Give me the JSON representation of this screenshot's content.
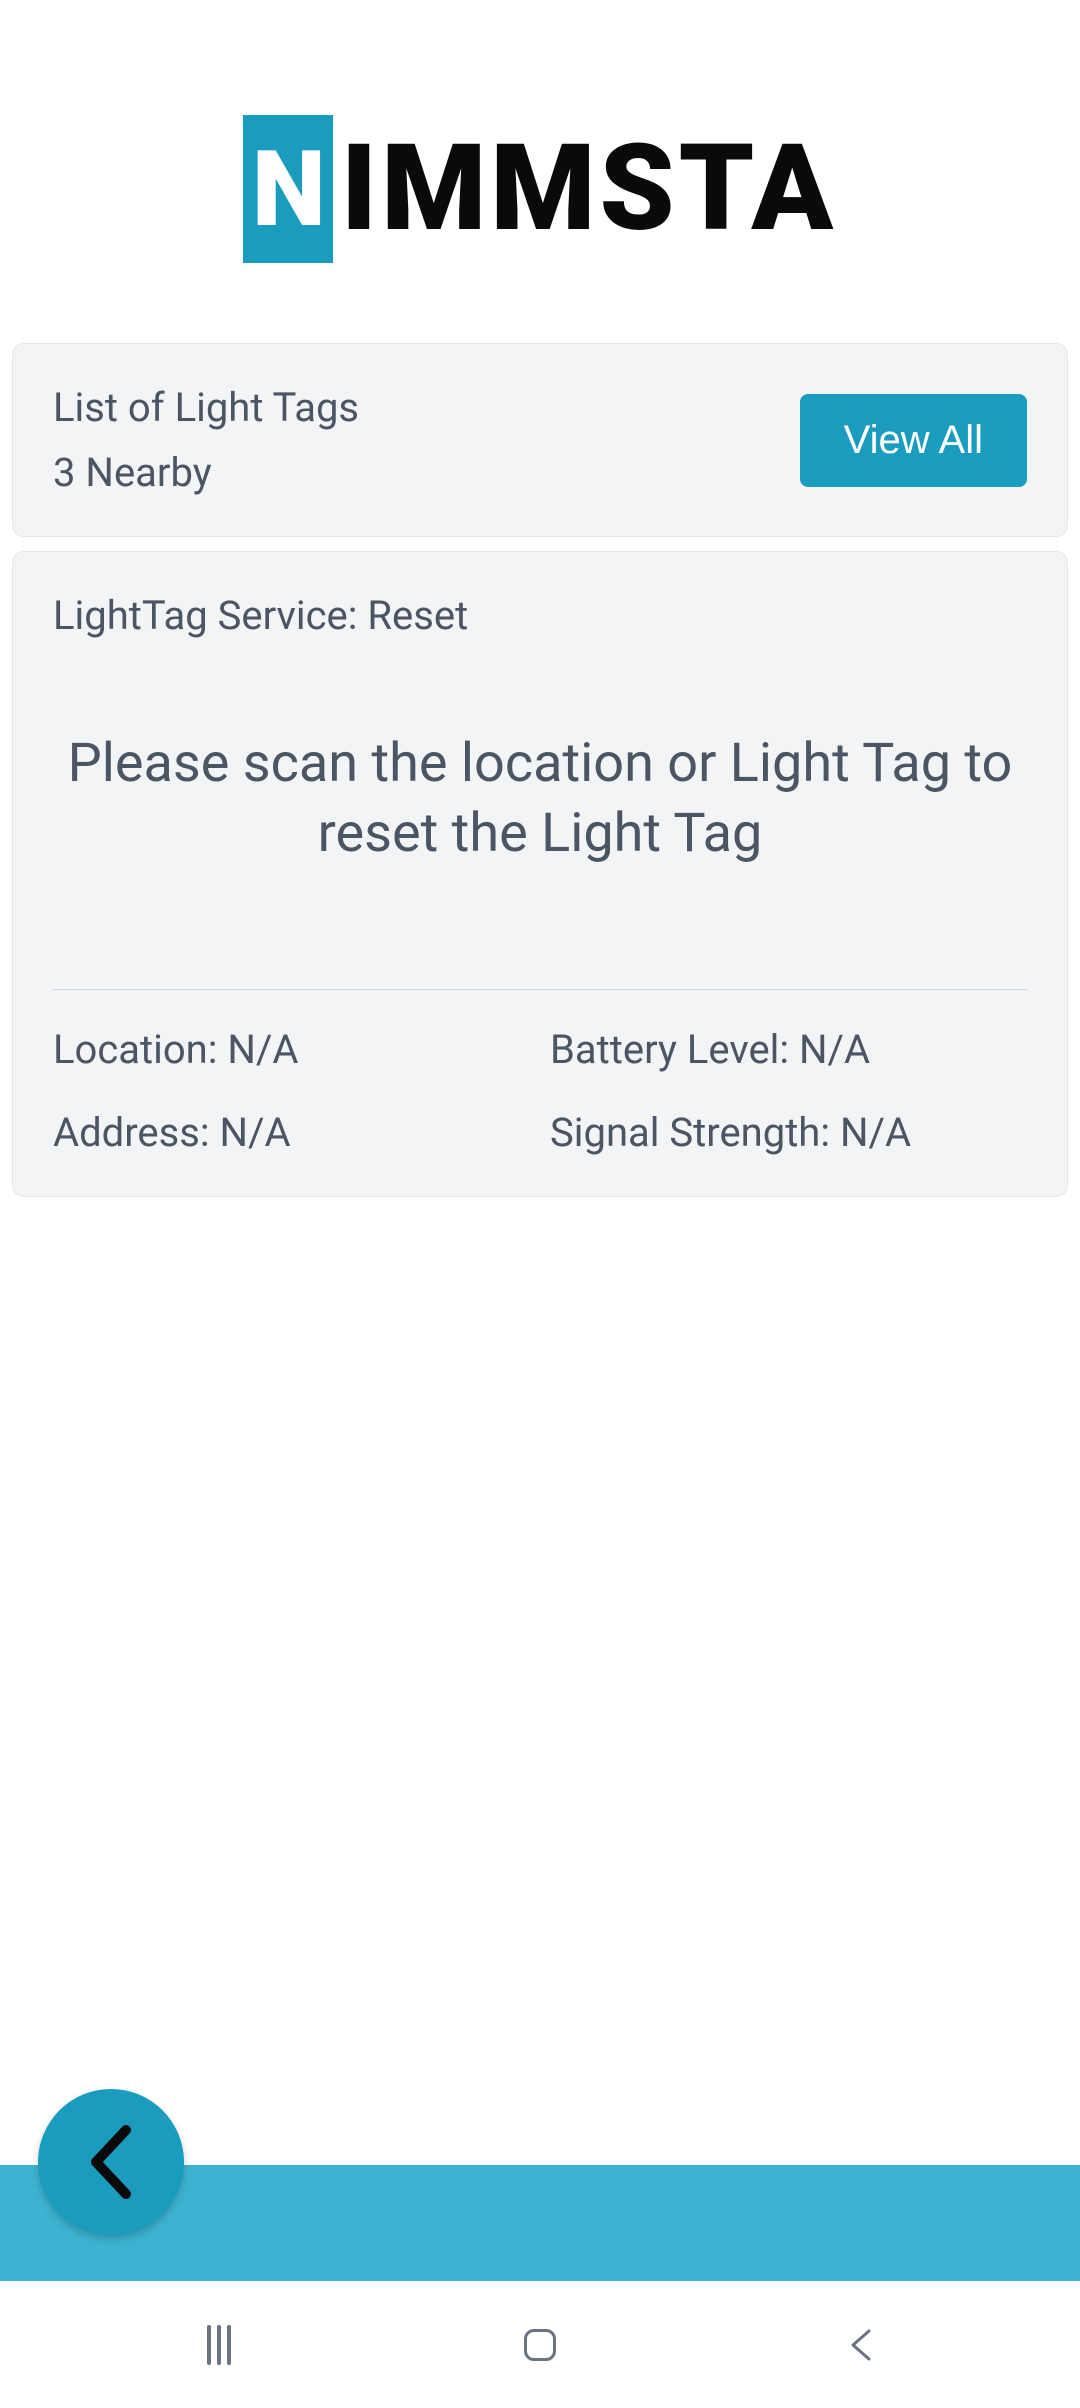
{
  "logo": {
    "highlighted_letter": "N",
    "remaining_text": "IMMSTA"
  },
  "list_card": {
    "title": "List of Light Tags",
    "subtitle": "3 Nearby",
    "button_label": "View All"
  },
  "service_card": {
    "title": "LightTag Service: Reset",
    "instruction": "Please scan the location or Light Tag to reset the Light Tag",
    "location_label": "Location: N/A",
    "address_label": "Address: N/A",
    "battery_label": "Battery Level: N/A",
    "signal_label": "Signal Strength: N/A"
  }
}
